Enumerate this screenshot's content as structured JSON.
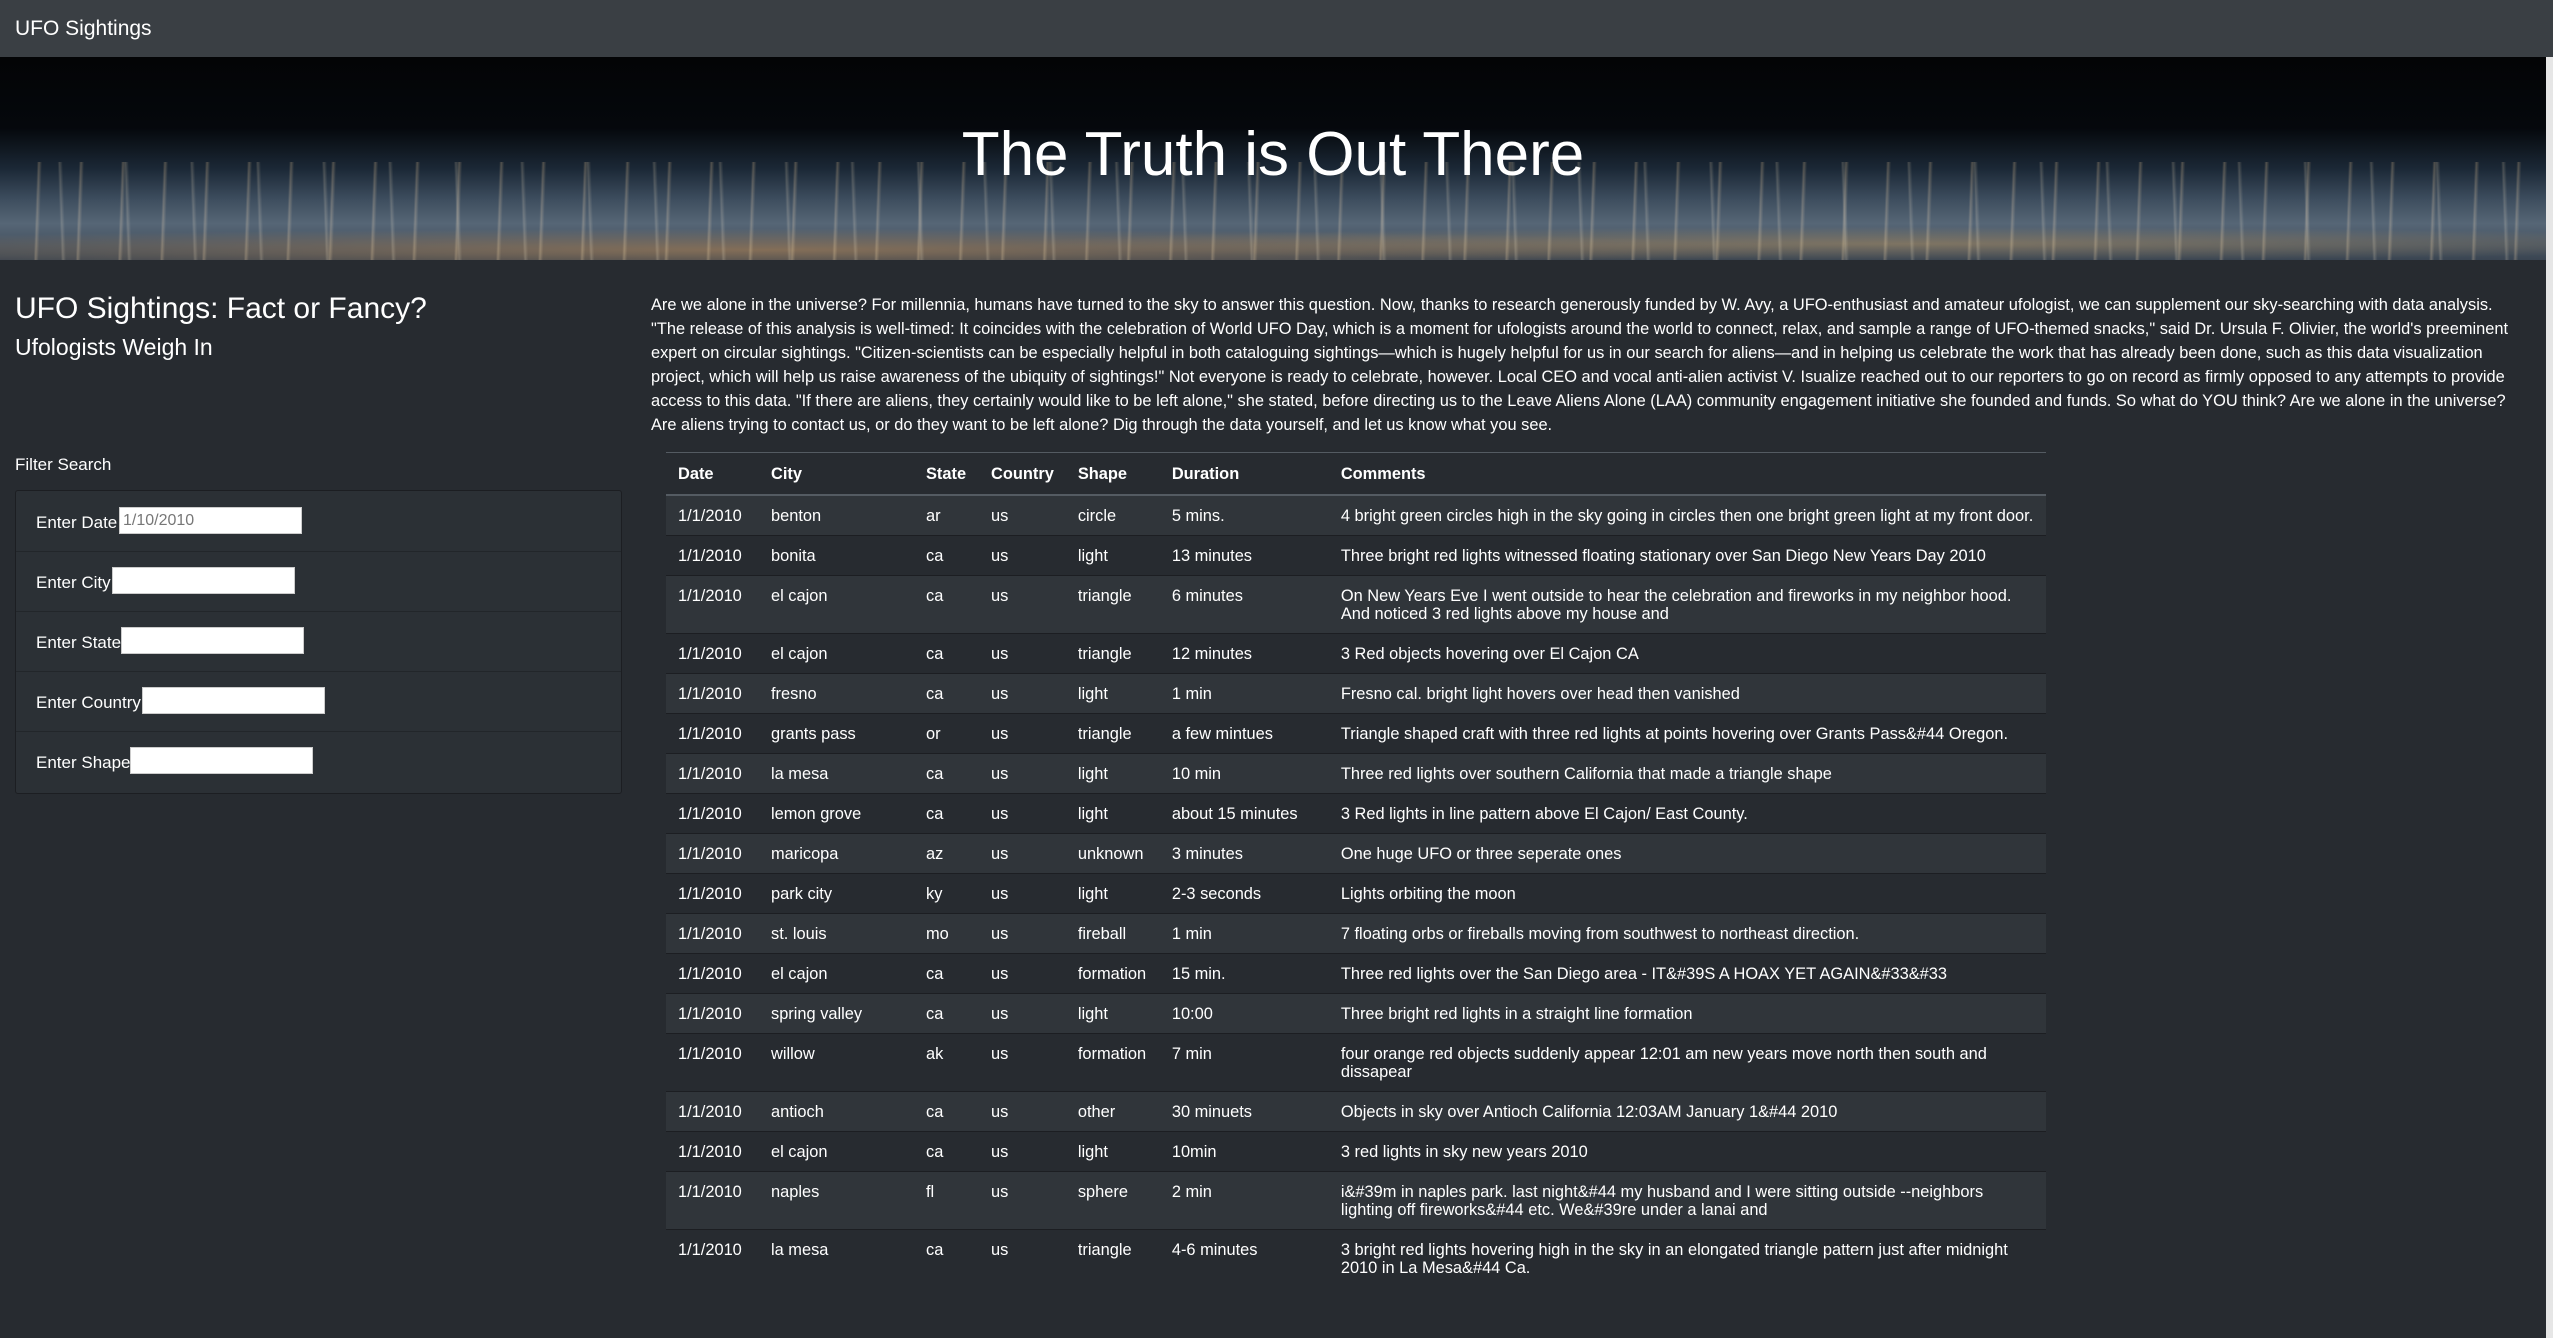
{
  "navbar": {
    "brand": "UFO Sightings"
  },
  "hero": {
    "title": "The Truth is Out There"
  },
  "sidebar": {
    "title": "UFO Sightings: Fact or Fancy?",
    "subtitle": "Ufologists Weigh In",
    "filter_label": "Filter Search",
    "filters": [
      {
        "label": "Enter Date",
        "placeholder": "1/10/2010",
        "value": ""
      },
      {
        "label": "Enter City",
        "placeholder": "",
        "value": ""
      },
      {
        "label": "Enter State",
        "placeholder": "",
        "value": ""
      },
      {
        "label": "Enter Country",
        "placeholder": "",
        "value": ""
      },
      {
        "label": "Enter Shape",
        "placeholder": "",
        "value": ""
      }
    ]
  },
  "intro": "Are we alone in the universe? For millennia, humans have turned to the sky to answer this question. Now, thanks to research generously funded by W. Avy, a UFO-enthusiast and amateur ufologist, we can supplement our sky-searching with data analysis. \"The release of this analysis is well-timed: It coincides with the celebration of World UFO Day, which is a moment for ufologists around the world to connect, relax, and sample a range of UFO-themed snacks,\" said Dr. Ursula F. Olivier, the world's preeminent expert on circular sightings. \"Citizen-scientists can be especially helpful in both cataloguing sightings—which is hugely helpful for us in our search for aliens—and in helping us celebrate the work that has already been done, such as this data visualization project, which will help us raise awareness of the ubiquity of sightings!\" Not everyone is ready to celebrate, however. Local CEO and vocal anti-alien activist V. Isualize reached out to our reporters to go on record as firmly opposed to any attempts to provide access to this data. \"If there are aliens, they certainly would like to be left alone,\" she stated, before directing us to the Leave Aliens Alone (LAA) community engagement initiative she founded and funds. So what do YOU think? Are we alone in the universe? Are aliens trying to contact us, or do they want to be left alone? Dig through the data yourself, and let us know what you see.",
  "table": {
    "headers": [
      "Date",
      "City",
      "State",
      "Country",
      "Shape",
      "Duration",
      "Comments"
    ],
    "rows": [
      [
        "1/1/2010",
        "benton",
        "ar",
        "us",
        "circle",
        "5 mins.",
        "4 bright green circles high in the sky going in circles then one bright green light at my front door."
      ],
      [
        "1/1/2010",
        "bonita",
        "ca",
        "us",
        "light",
        "13 minutes",
        "Three bright red lights witnessed floating stationary over San Diego New Years Day 2010"
      ],
      [
        "1/1/2010",
        "el cajon",
        "ca",
        "us",
        "triangle",
        "6 minutes",
        "On New Years Eve I went outside to hear the celebration and fireworks in my neighbor hood. And noticed 3 red lights above my house and"
      ],
      [
        "1/1/2010",
        "el cajon",
        "ca",
        "us",
        "triangle",
        "12 minutes",
        "3 Red objects hovering over El Cajon CA"
      ],
      [
        "1/1/2010",
        "fresno",
        "ca",
        "us",
        "light",
        "1 min",
        "Fresno cal. bright light hovers over head then vanished"
      ],
      [
        "1/1/2010",
        "grants pass",
        "or",
        "us",
        "triangle",
        "a few mintues",
        "Triangle shaped craft with three red lights at points hovering over Grants Pass&#44 Oregon."
      ],
      [
        "1/1/2010",
        "la mesa",
        "ca",
        "us",
        "light",
        "10 min",
        "Three red lights over southern California that made a triangle shape"
      ],
      [
        "1/1/2010",
        "lemon grove",
        "ca",
        "us",
        "light",
        "about 15 minutes",
        "3 Red lights in line pattern above El Cajon/ East County."
      ],
      [
        "1/1/2010",
        "maricopa",
        "az",
        "us",
        "unknown",
        "3 minutes",
        "One huge UFO or three seperate ones"
      ],
      [
        "1/1/2010",
        "park city",
        "ky",
        "us",
        "light",
        "2-3 seconds",
        "Lights orbiting the moon"
      ],
      [
        "1/1/2010",
        "st. louis",
        "mo",
        "us",
        "fireball",
        "1 min",
        "7 floating orbs or fireballs moving from southwest to northeast direction."
      ],
      [
        "1/1/2010",
        "el cajon",
        "ca",
        "us",
        "formation",
        "15 min.",
        "Three red lights over the San Diego area - IT&#39S A HOAX YET AGAIN&#33&#33"
      ],
      [
        "1/1/2010",
        "spring valley",
        "ca",
        "us",
        "light",
        "10:00",
        "Three bright red lights in a straight line formation"
      ],
      [
        "1/1/2010",
        "willow",
        "ak",
        "us",
        "formation",
        "7 min",
        "four orange red objects suddenly appear 12:01 am new years move north then south and dissapear"
      ],
      [
        "1/1/2010",
        "antioch",
        "ca",
        "us",
        "other",
        "30 minuets",
        "Objects in sky over Antioch California 12:03AM January 1&#44 2010"
      ],
      [
        "1/1/2010",
        "el cajon",
        "ca",
        "us",
        "light",
        "10min",
        "3 red lights in sky new years 2010"
      ],
      [
        "1/1/2010",
        "naples",
        "fl",
        "us",
        "sphere",
        "2 min",
        "i&#39m in naples park. last night&#44 my husband and I were sitting outside --neighbors lighting off fireworks&#44 etc. We&#39re under a lanai and"
      ],
      [
        "1/1/2010",
        "la mesa",
        "ca",
        "us",
        "triangle",
        "4-6 minutes",
        "3 bright red lights hovering high in the sky in an elongated triangle pattern just after midnight 2010 in La Mesa&#44 Ca."
      ]
    ]
  }
}
